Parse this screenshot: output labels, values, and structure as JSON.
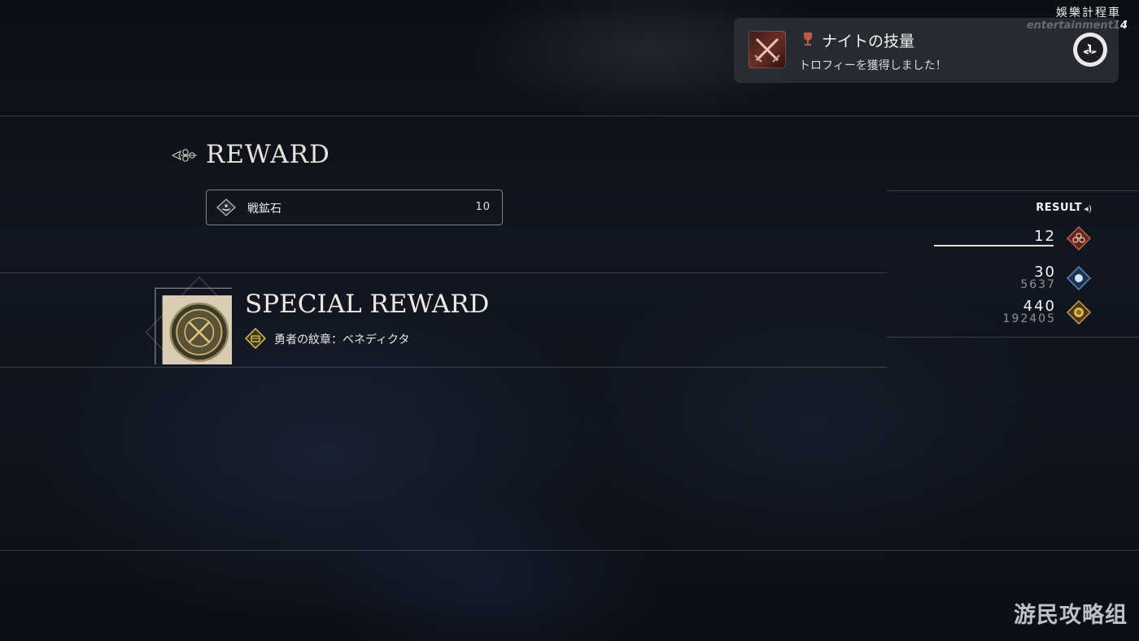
{
  "watermark_top": {
    "line1": "娛樂計程車",
    "line2": "entertainment14"
  },
  "watermark_bottom": "游民攻略组",
  "trophy": {
    "title": "ナイトの技量",
    "subtitle": "トロフィーを獲得しました！",
    "ps_icon": "ps-logo-icon"
  },
  "reward": {
    "title": "REWARD",
    "items": [
      {
        "name": "戦鉱石",
        "quantity": "10",
        "icon": "ore-icon"
      }
    ]
  },
  "special_reward": {
    "title": "SPECIAL REWARD",
    "item": {
      "name": "勇者の紋章：ベネディクタ",
      "icon": "crest-icon"
    }
  },
  "result": {
    "label": "RESULT",
    "rows": [
      {
        "value": "12",
        "sub": "",
        "icon": "level-icon",
        "progress": 0.98,
        "color": "#c0604a"
      },
      {
        "value": "30",
        "sub": "5637",
        "icon": "exp-icon",
        "color": "#5d88b8"
      },
      {
        "value": "440",
        "sub": "192405",
        "icon": "gil-icon",
        "color": "#c8a04a"
      }
    ]
  }
}
